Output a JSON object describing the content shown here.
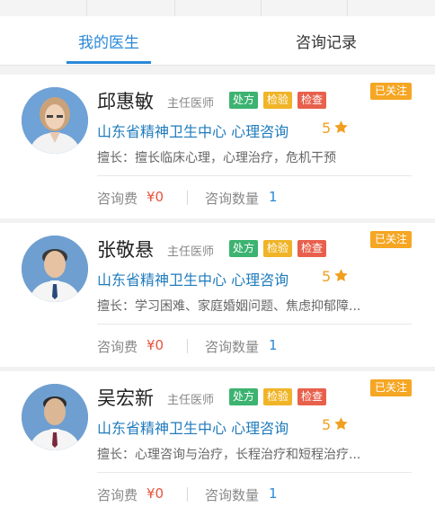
{
  "tabs": [
    {
      "label": "我的医生",
      "active": true
    },
    {
      "label": "咨询记录",
      "active": false
    }
  ],
  "colors": {
    "accent": "#2a88d8",
    "hospital_text": "#1f7bbd",
    "fee": "#e5533d",
    "followed": "#f5a623",
    "badge_prescription": "#3cb371",
    "badge_test": "#f0b428",
    "badge_exam": "#e8604c"
  },
  "doctors": [
    {
      "name": "邱惠敏",
      "title": "主任医师",
      "badges": [
        "处方",
        "检验",
        "检查"
      ],
      "followed_label": "已关注",
      "hospital": "山东省精神卫生中心 心理咨询",
      "rating": "5",
      "specialty": "擅长：擅长临床心理，心理治疗，危机干预",
      "fee_label": "咨询费",
      "fee_value": "¥0",
      "count_label": "咨询数量",
      "count_value": "1",
      "avatar": "female-doctor-photo"
    },
    {
      "name": "张敬悬",
      "title": "主任医师",
      "badges": [
        "处方",
        "检验",
        "检查"
      ],
      "followed_label": "已关注",
      "hospital": "山东省精神卫生中心 心理咨询",
      "rating": "5",
      "specialty": "擅长：学习困难、家庭婚姻问题、焦虑抑郁障...",
      "fee_label": "咨询费",
      "fee_value": "¥0",
      "count_label": "咨询数量",
      "count_value": "1",
      "avatar": "male-doctor-photo"
    },
    {
      "name": "吴宏新",
      "title": "主任医师",
      "badges": [
        "处方",
        "检验",
        "检查"
      ],
      "followed_label": "已关注",
      "hospital": "山东省精神卫生中心 心理咨询",
      "rating": "5",
      "specialty": "擅长：心理咨询与治疗，长程治疗和短程治疗...",
      "fee_label": "咨询费",
      "fee_value": "¥0",
      "count_label": "咨询数量",
      "count_value": "1",
      "avatar": "male-doctor-photo"
    }
  ]
}
